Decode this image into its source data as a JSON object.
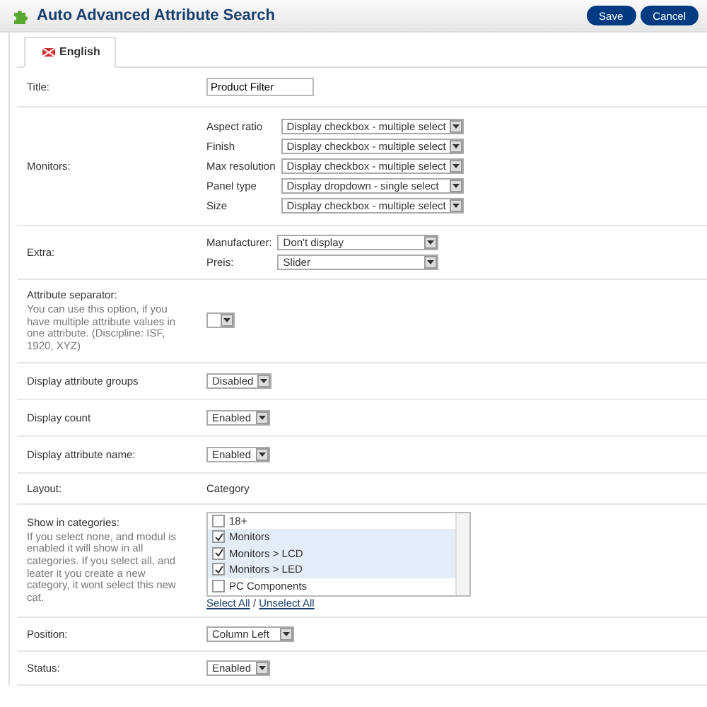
{
  "header": {
    "title": "Auto Advanced Attribute Search",
    "buttons": [
      "Save",
      "Cancel"
    ]
  },
  "tabs": [
    {
      "label": "English",
      "selected": true
    }
  ],
  "title_field": {
    "label": "Title:",
    "value": "Product Filter"
  },
  "monitors": {
    "label": "Monitors:",
    "attributes": [
      {
        "name": "Aspect ratio",
        "value": "Display checkbox - multiple select"
      },
      {
        "name": "Finish",
        "value": "Display checkbox - multiple select"
      },
      {
        "name": "Max resolution",
        "value": "Display checkbox - multiple select"
      },
      {
        "name": "Panel type",
        "value": "Display dropdown - single select"
      },
      {
        "name": "Size",
        "value": "Display checkbox - multiple select"
      }
    ]
  },
  "extra": {
    "label": "Extra:",
    "attributes": [
      {
        "name": "Manufacturer:",
        "value": "Don't display"
      },
      {
        "name": "Preis:",
        "value": "Slider"
      }
    ]
  },
  "separator": {
    "label": "Attribute separator:",
    "help": "You can use this option, if you have multiple attribute values in one attribute. (Discipline: ISF, 1920, XYZ)"
  },
  "options": [
    {
      "label": "Display attribute groups",
      "value": "Disabled"
    },
    {
      "label": "Display count",
      "value": "Enabled"
    },
    {
      "label": "Display attribute name:",
      "value": "Enabled"
    }
  ],
  "layout": {
    "label": "Layout:",
    "value": "Category"
  },
  "categories": {
    "label": "Show in categories:",
    "help": "If you select none, and modul is enabled it will show in all categories. If you select all, and leater it you create a new category, it wont select this new cat.",
    "items": [
      {
        "name": "18+",
        "checked": false
      },
      {
        "name": "Monitors",
        "checked": true
      },
      {
        "name": "Monitors > LCD",
        "checked": true
      },
      {
        "name": "Monitors > LED",
        "checked": true
      },
      {
        "name": "PC Components",
        "checked": false
      }
    ],
    "select_all": "Select All",
    "separator": "/",
    "unselect_all": "Unselect All"
  },
  "bottom_options": [
    {
      "label": "Position:",
      "value": "Column Left"
    },
    {
      "label": "Status:",
      "value": "Enabled"
    }
  ]
}
